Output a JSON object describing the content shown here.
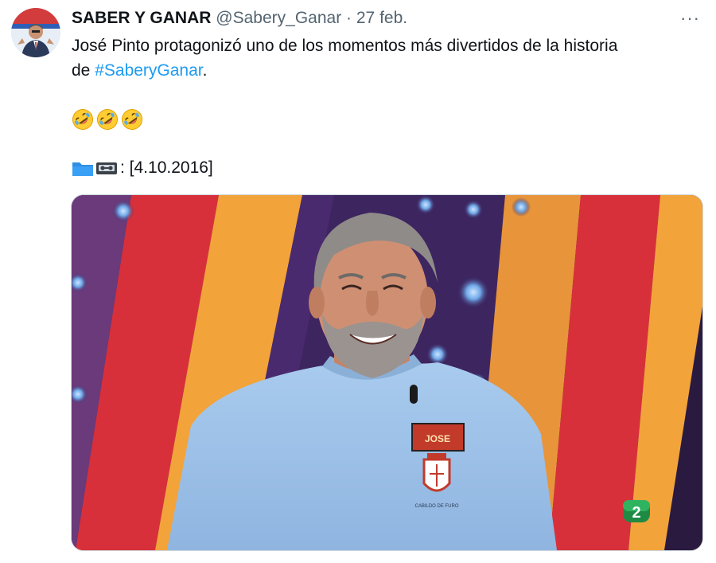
{
  "tweet": {
    "display_name": "SABER Y GANAR",
    "handle": "@Sabery_Ganar",
    "separator": "·",
    "date": "27 feb.",
    "more_label": "···",
    "text_line1": "José Pinto protagonizó uno de los momentos más divertidos de la historia",
    "text_line2_prefix": "de",
    "hashtag": "#SaberyGanar",
    "text_line2_suffix": ".",
    "emojis": [
      "rolling-on-floor-laughing-emoji",
      "rolling-on-floor-laughing-emoji",
      "rolling-on-floor-laughing-emoji"
    ],
    "date_tag_icons": [
      "folder-icon",
      "videocassette-icon"
    ],
    "date_tag_text": ": [4.10.2016]"
  },
  "media": {
    "badge_name": "JOSE",
    "channel_logo": "2",
    "crest_caption": "CABILDO DE FURO"
  },
  "colors": {
    "link": "#1d9bf0",
    "text": "#0f1419",
    "secondary": "#536471",
    "shirt": "#9cc0e6",
    "stripe_orange": "#f5a33a",
    "stripe_red": "#d8303a",
    "stage_purple": "#4a2a6e"
  }
}
